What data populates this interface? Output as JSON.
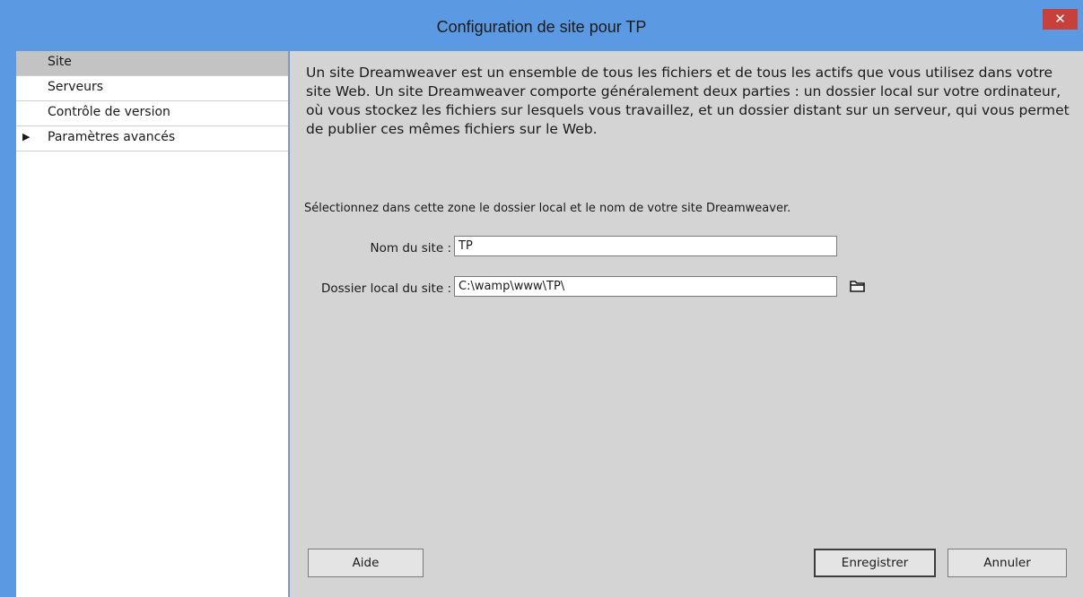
{
  "window": {
    "title": "Configuration de site pour TP",
    "close_glyph": "✕"
  },
  "sidebar": {
    "items": [
      {
        "label": "Site",
        "active": true,
        "expandable": false
      },
      {
        "label": "Serveurs",
        "active": false,
        "expandable": false
      },
      {
        "label": "Contrôle de version",
        "active": false,
        "expandable": false
      },
      {
        "label": "Paramètres avancés",
        "active": false,
        "expandable": true,
        "arrow": "▶"
      }
    ]
  },
  "main": {
    "intro": "Un site Dreamweaver est un ensemble de tous les fichiers et de tous les actifs que vous utilisez dans votre site Web. Un site Dreamweaver comporte généralement deux parties : un dossier local sur votre ordinateur, où vous stockez les fichiers sur lesquels vous travaillez, et un dossier distant sur un serveur, qui vous permet de publier ces mêmes fichiers sur le Web.",
    "select_text": "Sélectionnez dans cette zone le dossier local et le nom de votre site Dreamweaver.",
    "site_name": {
      "label": "Nom du site :",
      "value": "TP"
    },
    "local_folder": {
      "label": "Dossier local du site :",
      "value": "C:\\wamp\\www\\TP\\",
      "browse_icon": "folder-icon"
    }
  },
  "buttons": {
    "help": "Aide",
    "save": "Enregistrer",
    "cancel": "Annuler"
  },
  "colors": {
    "titlebar": "#5b9ae2",
    "close": "#c7413c",
    "panel": "#d4d4d4",
    "active_nav": "#c3c3c3"
  }
}
